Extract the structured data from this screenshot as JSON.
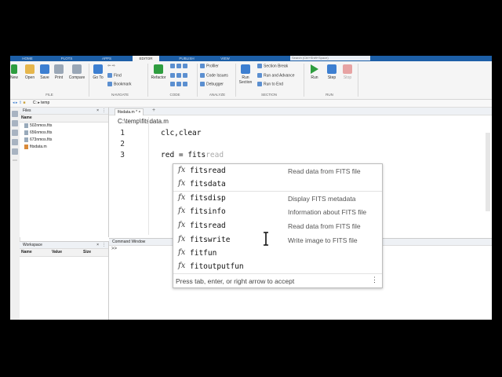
{
  "tabs": [
    "HOME",
    "PLOTS",
    "APPS",
    "EDITOR",
    "PUBLISH",
    "VIEW"
  ],
  "active_tab": "EDITOR",
  "search": {
    "placeholder": "Search (Ctrl+Shift+Space)"
  },
  "toolstrip": {
    "file": {
      "new": "New",
      "open": "Open",
      "save": "Save",
      "print": "Print",
      "compare": "Compare",
      "section_label": "FILE"
    },
    "navigate": {
      "goto": "Go To",
      "find": "Find",
      "bookmark": "Bookmark",
      "section_label": "NAVIGATE"
    },
    "code": {
      "refactor": "Refactor",
      "section_label": "CODE"
    },
    "analyze": {
      "profiler": "Profiler",
      "code_issues": "Code Issues",
      "debugger": "Debugger",
      "section_label": "ANALYZE"
    },
    "section": {
      "run_section": "Run Section",
      "section_break": "Section Break",
      "run_and_advance": "Run and Advance",
      "run_to_end": "Run to End",
      "section_label": "SECTION"
    },
    "run": {
      "run": "Run",
      "step": "Step",
      "stop": "Stop",
      "section_label": "RUN"
    }
  },
  "address": {
    "path": "C: ▸ temp"
  },
  "files_panel": {
    "title": "Files",
    "column": "Name",
    "items": [
      "502nmos.fits",
      "656nmos.fits",
      "673nmos.fits",
      "fitsdata.m"
    ]
  },
  "workspace_panel": {
    "title": "Workspace",
    "columns": [
      "Name",
      "Value",
      "Size"
    ]
  },
  "editor": {
    "tab_label": "fitsdata.m *",
    "path": "C:\\temp\\fitsdata.m",
    "lines": [
      {
        "num": "1",
        "text": "clc,clear"
      },
      {
        "num": "2",
        "text": ""
      },
      {
        "num": "3",
        "text": "red = fits",
        "ghost": "read"
      }
    ]
  },
  "command_window": {
    "title": "Command Window",
    "prompt": ">>"
  },
  "autocomplete": {
    "icon": "fx",
    "items": [
      {
        "name": "fitsread",
        "desc": "Read data from FITS file"
      },
      {
        "name": "fitsdata",
        "desc": ""
      },
      {
        "name": "fitsdisp",
        "desc": "Display FITS metadata"
      },
      {
        "name": "fitsinfo",
        "desc": "Information about FITS file"
      },
      {
        "name": "fitsread",
        "desc": "Read data from FITS file"
      },
      {
        "name": "fitswrite",
        "desc": "Write image to FITS file"
      },
      {
        "name": "fitfun",
        "desc": ""
      },
      {
        "name": "fitoutputfun",
        "desc": ""
      }
    ],
    "footer": "Press tab, enter, or right arrow to accept",
    "more": "⋮"
  },
  "colors": {
    "tabbar": "#1d5fa7",
    "accent": "#3d7fd1",
    "run_green": "#2e9d3f"
  }
}
